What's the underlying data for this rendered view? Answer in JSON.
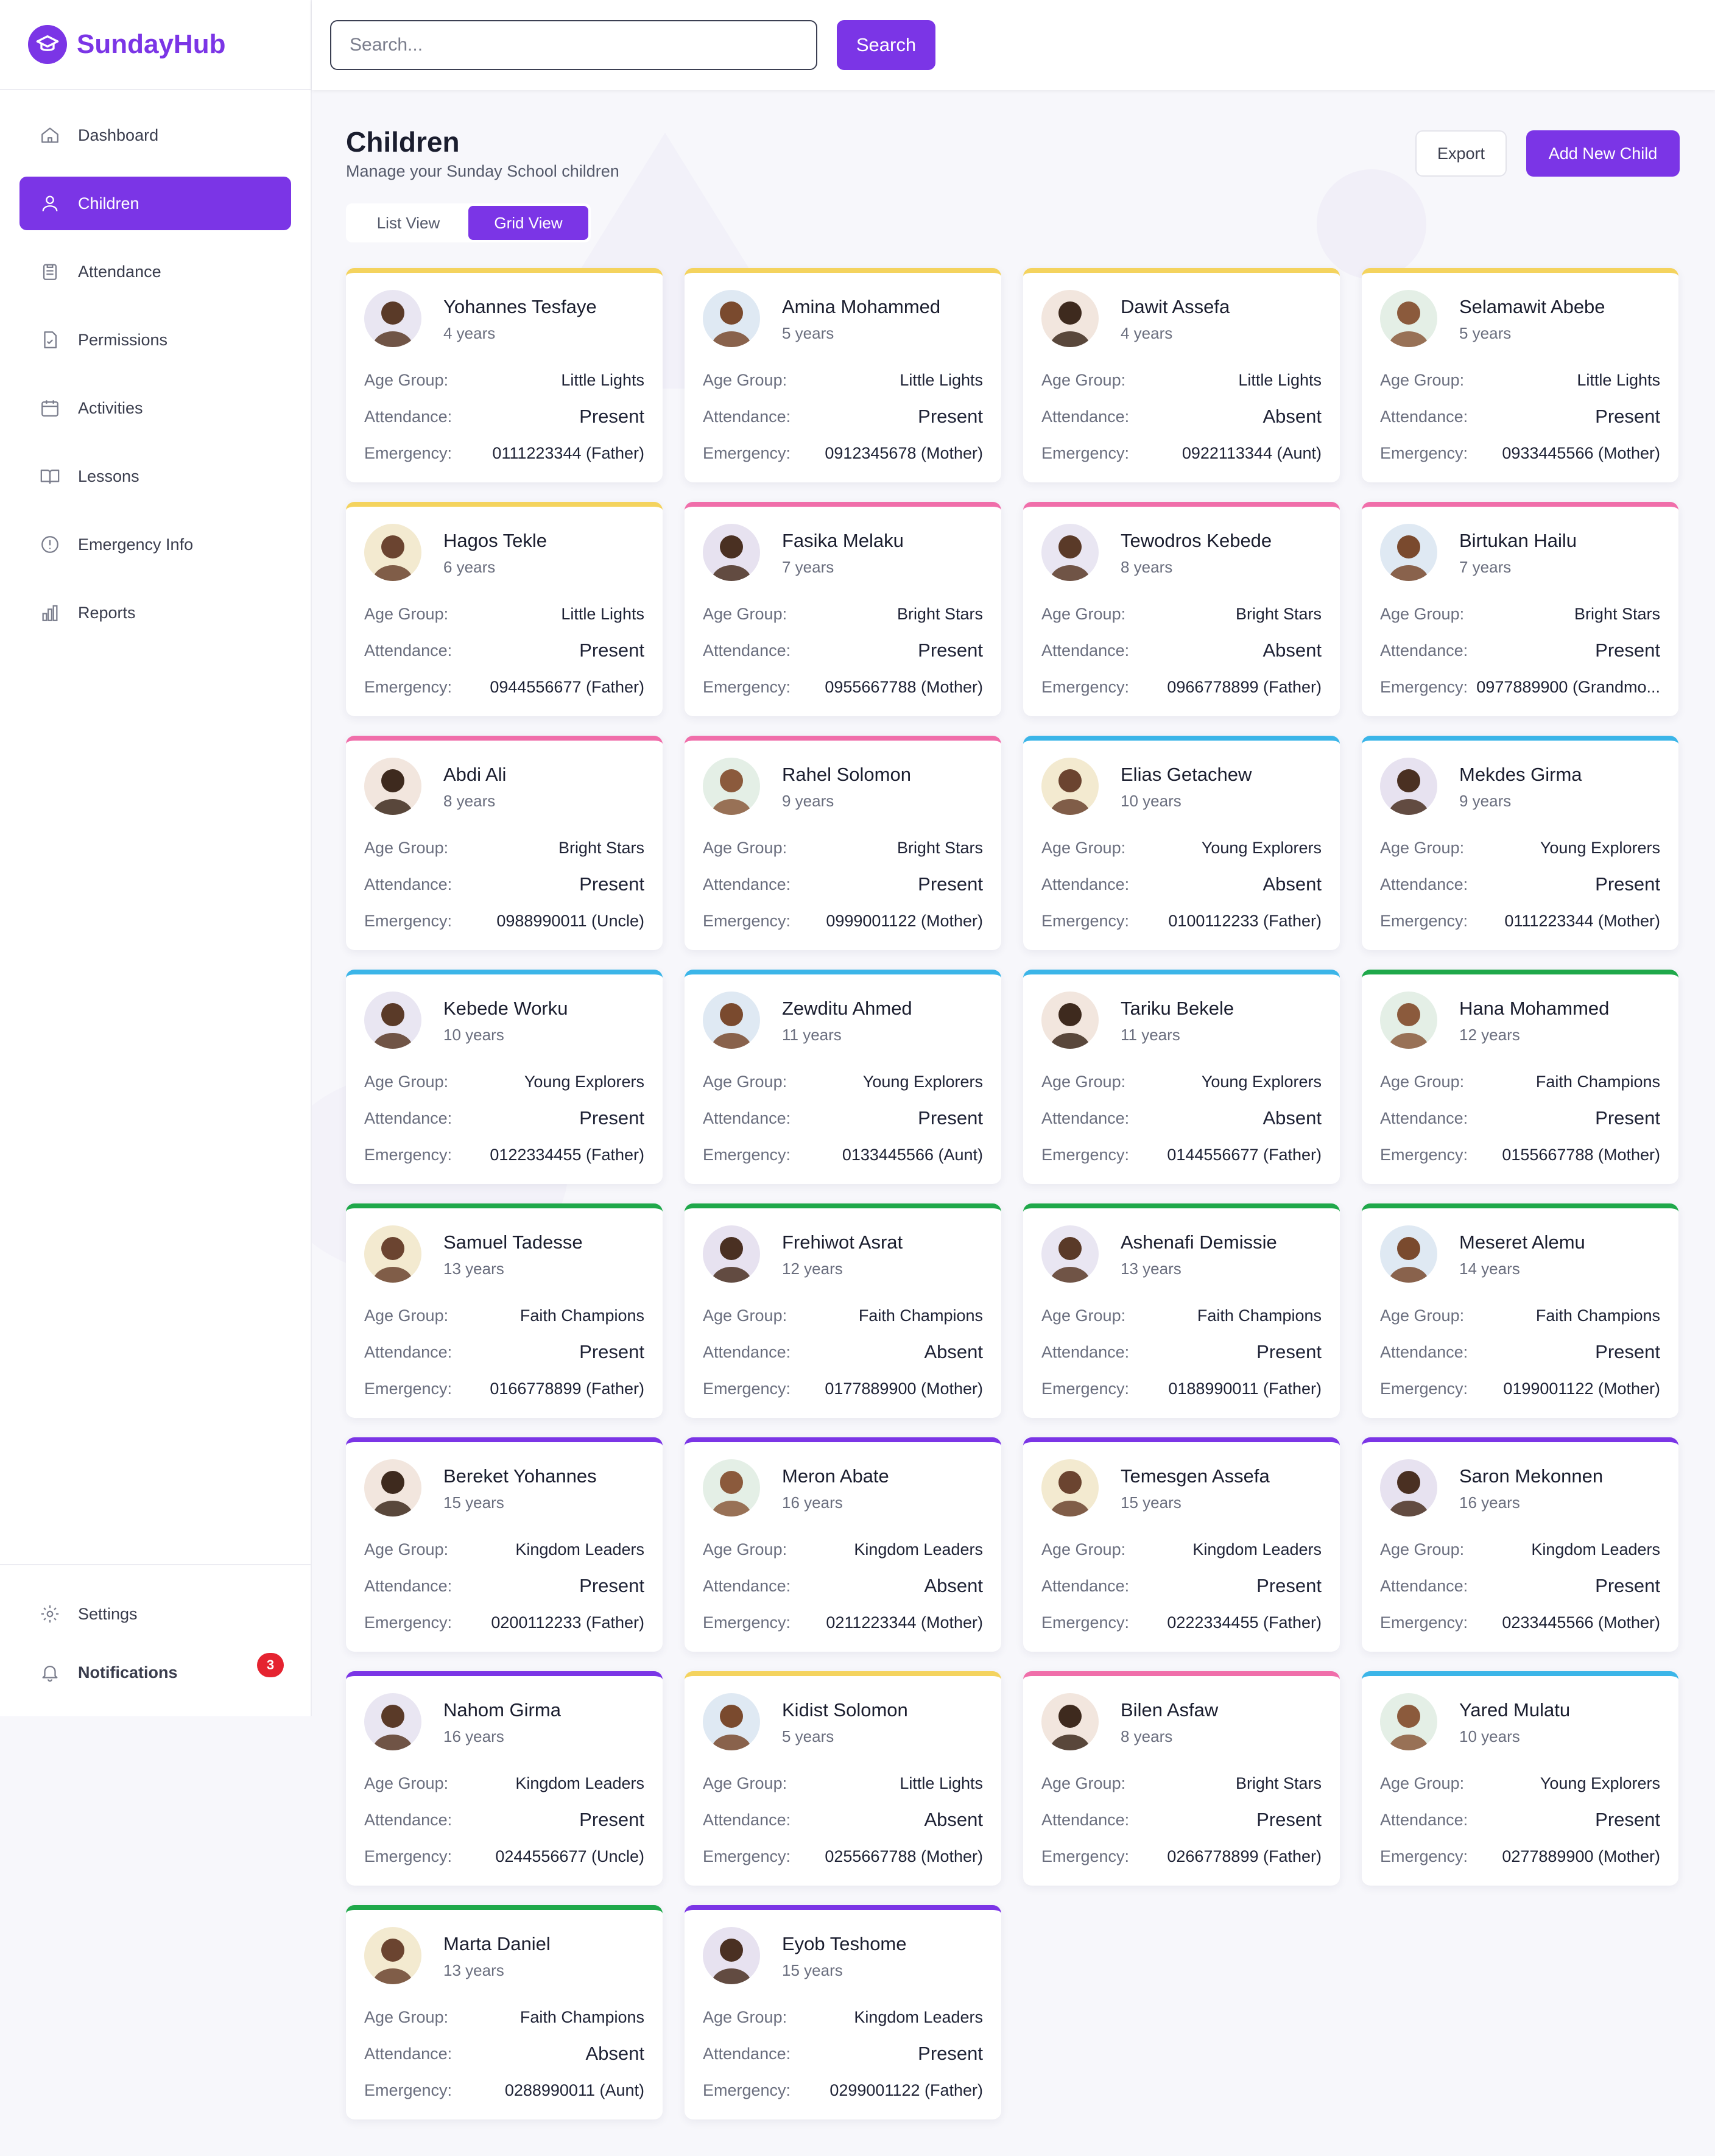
{
  "app": {
    "name": "SundayHub"
  },
  "search": {
    "placeholder": "Search...",
    "button_label": "Search"
  },
  "sidebar": {
    "items": [
      {
        "label": "Dashboard",
        "icon": "home-icon"
      },
      {
        "label": "Children",
        "icon": "user-icon"
      },
      {
        "label": "Attendance",
        "icon": "clipboard-icon"
      },
      {
        "label": "Permissions",
        "icon": "file-check-icon"
      },
      {
        "label": "Activities",
        "icon": "calendar-icon"
      },
      {
        "label": "Lessons",
        "icon": "book-icon"
      },
      {
        "label": "Emergency Info",
        "icon": "alert-circle-icon"
      },
      {
        "label": "Reports",
        "icon": "bar-chart-icon"
      }
    ],
    "active_index": 1,
    "settings_label": "Settings",
    "notifications_label": "Notifications",
    "notifications_count": "3"
  },
  "page": {
    "title": "Children",
    "subtitle": "Manage your Sunday School children",
    "export_label": "Export",
    "add_label": "Add New Child",
    "view_list_label": "List View",
    "view_grid_label": "Grid View"
  },
  "labels": {
    "age_group": "Age Group:",
    "attendance": "Attendance:",
    "emergency": "Emergency:"
  },
  "group_colors": {
    "Little Lights": "#f4d35e",
    "Bright Stars": "#f06eaa",
    "Young Explorers": "#3bb5e8",
    "Faith Champions": "#1fa84a",
    "Kingdom Leaders": "#7b35e6"
  },
  "status_colors": {
    "Present": "#1fa84a",
    "Absent": "#e52330"
  },
  "children": [
    {
      "name": "Yohannes Tesfaye",
      "age": "4 years",
      "group": "Little Lights",
      "status": "Present",
      "emergency": "0111223344 (Father)"
    },
    {
      "name": "Amina Mohammed",
      "age": "5 years",
      "group": "Little Lights",
      "status": "Present",
      "emergency": "0912345678 (Mother)"
    },
    {
      "name": "Dawit Assefa",
      "age": "4 years",
      "group": "Little Lights",
      "status": "Absent",
      "emergency": "0922113344 (Aunt)"
    },
    {
      "name": "Selamawit Abebe",
      "age": "5 years",
      "group": "Little Lights",
      "status": "Present",
      "emergency": "0933445566 (Mother)"
    },
    {
      "name": "Hagos Tekle",
      "age": "6 years",
      "group": "Little Lights",
      "status": "Present",
      "emergency": "0944556677 (Father)"
    },
    {
      "name": "Fasika Melaku",
      "age": "7 years",
      "group": "Bright Stars",
      "status": "Present",
      "emergency": "0955667788 (Mother)"
    },
    {
      "name": "Tewodros Kebede",
      "age": "8 years",
      "group": "Bright Stars",
      "status": "Absent",
      "emergency": "0966778899 (Father)"
    },
    {
      "name": "Birtukan Hailu",
      "age": "7 years",
      "group": "Bright Stars",
      "status": "Present",
      "emergency": "0977889900 (Grandmo..."
    },
    {
      "name": "Abdi Ali",
      "age": "8 years",
      "group": "Bright Stars",
      "status": "Present",
      "emergency": "0988990011 (Uncle)"
    },
    {
      "name": "Rahel Solomon",
      "age": "9 years",
      "group": "Bright Stars",
      "status": "Present",
      "emergency": "0999001122 (Mother)"
    },
    {
      "name": "Elias Getachew",
      "age": "10 years",
      "group": "Young Explorers",
      "status": "Absent",
      "emergency": "0100112233 (Father)"
    },
    {
      "name": "Mekdes Girma",
      "age": "9 years",
      "group": "Young Explorers",
      "status": "Present",
      "emergency": "0111223344 (Mother)"
    },
    {
      "name": "Kebede Worku",
      "age": "10 years",
      "group": "Young Explorers",
      "status": "Present",
      "emergency": "0122334455 (Father)"
    },
    {
      "name": "Zewditu Ahmed",
      "age": "11 years",
      "group": "Young Explorers",
      "status": "Present",
      "emergency": "0133445566 (Aunt)"
    },
    {
      "name": "Tariku Bekele",
      "age": "11 years",
      "group": "Young Explorers",
      "status": "Absent",
      "emergency": "0144556677 (Father)"
    },
    {
      "name": "Hana Mohammed",
      "age": "12 years",
      "group": "Faith Champions",
      "status": "Present",
      "emergency": "0155667788 (Mother)"
    },
    {
      "name": "Samuel Tadesse",
      "age": "13 years",
      "group": "Faith Champions",
      "status": "Present",
      "emergency": "0166778899 (Father)"
    },
    {
      "name": "Frehiwot Asrat",
      "age": "12 years",
      "group": "Faith Champions",
      "status": "Absent",
      "emergency": "0177889900 (Mother)"
    },
    {
      "name": "Ashenafi Demissie",
      "age": "13 years",
      "group": "Faith Champions",
      "status": "Present",
      "emergency": "0188990011 (Father)"
    },
    {
      "name": "Meseret Alemu",
      "age": "14 years",
      "group": "Faith Champions",
      "status": "Present",
      "emergency": "0199001122 (Mother)"
    },
    {
      "name": "Bereket Yohannes",
      "age": "15 years",
      "group": "Kingdom Leaders",
      "status": "Present",
      "emergency": "0200112233 (Father)"
    },
    {
      "name": "Meron Abate",
      "age": "16 years",
      "group": "Kingdom Leaders",
      "status": "Absent",
      "emergency": "0211223344 (Mother)"
    },
    {
      "name": "Temesgen Assefa",
      "age": "15 years",
      "group": "Kingdom Leaders",
      "status": "Present",
      "emergency": "0222334455 (Father)"
    },
    {
      "name": "Saron Mekonnen",
      "age": "16 years",
      "group": "Kingdom Leaders",
      "status": "Present",
      "emergency": "0233445566 (Mother)"
    },
    {
      "name": "Nahom Girma",
      "age": "16 years",
      "group": "Kingdom Leaders",
      "status": "Present",
      "emergency": "0244556677 (Uncle)"
    },
    {
      "name": "Kidist Solomon",
      "age": "5 years",
      "group": "Little Lights",
      "status": "Absent",
      "emergency": "0255667788 (Mother)"
    },
    {
      "name": "Bilen Asfaw",
      "age": "8 years",
      "group": "Bright Stars",
      "status": "Present",
      "emergency": "0266778899 (Father)"
    },
    {
      "name": "Yared Mulatu",
      "age": "10 years",
      "group": "Young Explorers",
      "status": "Present",
      "emergency": "0277889900 (Mother)"
    },
    {
      "name": "Marta Daniel",
      "age": "13 years",
      "group": "Faith Champions",
      "status": "Absent",
      "emergency": "0288990011 (Aunt)"
    },
    {
      "name": "Eyob Teshome",
      "age": "15 years",
      "group": "Kingdom Leaders",
      "status": "Present",
      "emergency": "0299001122 (Father)"
    }
  ]
}
